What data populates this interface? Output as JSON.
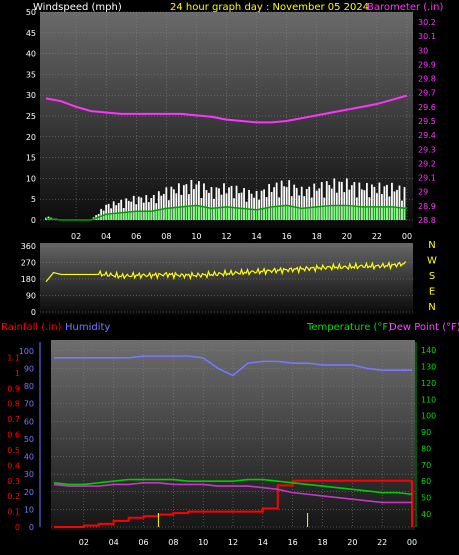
{
  "header": {
    "wind_label": "Windspeed (mph)",
    "title": "24 hour graph day : November 05 2024",
    "baro_label": "Barometer (.in)"
  },
  "colors": {
    "windspeed": "#ffffff",
    "wind_avg": "#00a000",
    "wind_light": "#7cff7c",
    "barometer": "#ff33ff",
    "direction": "#ffff00",
    "rainfall": "#ff0000",
    "humidity": "#7777ff",
    "temperature": "#00cc00",
    "dewpoint": "#cc33cc",
    "tick_yellow": "#ffff00",
    "cardinal": "#ffff00"
  },
  "x_ticks": [
    "02",
    "04",
    "06",
    "08",
    "10",
    "12",
    "14",
    "16",
    "18",
    "20",
    "22",
    "00"
  ],
  "chart_data": [
    {
      "type": "line",
      "name": "wind-barometer",
      "x": [
        0,
        1,
        2,
        3,
        4,
        5,
        6,
        7,
        8,
        9,
        10,
        11,
        12,
        13,
        14,
        15,
        16,
        17,
        18,
        19,
        20,
        21,
        22,
        23,
        24
      ],
      "series": [
        {
          "name": "Windspeed (mph)",
          "axis": "left",
          "values": [
            1,
            0,
            0,
            0,
            4,
            5,
            6,
            6,
            8,
            9,
            10,
            8,
            9,
            8,
            7,
            9,
            10,
            8,
            9,
            10,
            10,
            9,
            9,
            9,
            8
          ]
        },
        {
          "name": "Barometer (.in)",
          "axis": "right",
          "values": [
            29.66,
            29.64,
            29.6,
            29.57,
            29.56,
            29.55,
            29.55,
            29.55,
            29.55,
            29.55,
            29.54,
            29.53,
            29.51,
            29.5,
            29.49,
            29.49,
            29.5,
            29.52,
            29.54,
            29.56,
            29.58,
            29.6,
            29.62,
            29.65,
            29.68
          ]
        }
      ],
      "left_ticks": [
        "0",
        "5",
        "10",
        "15",
        "20",
        "25",
        "30",
        "35",
        "40",
        "45",
        "50"
      ],
      "right_ticks": [
        "28.8",
        "28.9",
        "29",
        "29.1",
        "29.2",
        "29.3",
        "29.4",
        "29.5",
        "29.6",
        "29.7",
        "29.8",
        "29.9",
        "30",
        "30.1",
        "30.2"
      ]
    },
    {
      "type": "scatter",
      "name": "wind-direction",
      "x": [
        0,
        0.5,
        1,
        2,
        3,
        4,
        5,
        6,
        7,
        8,
        9,
        10,
        11,
        12,
        13,
        14,
        15,
        16,
        17,
        18,
        19,
        20,
        21,
        22,
        23,
        24
      ],
      "values": [
        165,
        215,
        205,
        205,
        205,
        205,
        195,
        200,
        200,
        205,
        200,
        200,
        205,
        210,
        215,
        220,
        225,
        230,
        235,
        240,
        245,
        245,
        250,
        250,
        255,
        265
      ],
      "left_ticks": [
        "0",
        "90",
        "180",
        "270",
        "360"
      ],
      "cardinal_labels": [
        "N",
        "W",
        "S",
        "E",
        "N"
      ]
    },
    {
      "type": "line",
      "name": "rain-humidity-temperature",
      "x": [
        0,
        1,
        2,
        3,
        4,
        5,
        6,
        7,
        8,
        9,
        10,
        11,
        12,
        13,
        14,
        15,
        16,
        17,
        18,
        19,
        20,
        21,
        22,
        23,
        24
      ],
      "series": [
        {
          "name": "Rainfall (.in)",
          "axis": "rain",
          "values": [
            0.0,
            0.0,
            0.01,
            0.02,
            0.04,
            0.06,
            0.07,
            0.08,
            0.09,
            0.1,
            0.1,
            0.1,
            0.1,
            0.1,
            0.12,
            0.27,
            0.3,
            0.3,
            0.3,
            0.3,
            0.3,
            0.3,
            0.3,
            0.3,
            0.3
          ]
        },
        {
          "name": "Humidity",
          "axis": "left",
          "values": [
            96,
            96,
            96,
            96,
            96,
            96,
            97,
            97,
            97,
            97,
            96,
            90,
            86,
            93,
            94,
            94,
            93,
            93,
            92,
            92,
            92,
            90,
            89,
            89,
            89
          ]
        },
        {
          "name": "Temperature (°F)",
          "axis": "right",
          "values": [
            59,
            58,
            58,
            59,
            60,
            61,
            61,
            61,
            61,
            60,
            60,
            60,
            60,
            61,
            61,
            60,
            59,
            58,
            57,
            56,
            55,
            54,
            53,
            53,
            52
          ]
        },
        {
          "name": "Dew Point (°F)",
          "axis": "right",
          "values": [
            58,
            57,
            57,
            57,
            58,
            58,
            59,
            59,
            58,
            58,
            58,
            57,
            57,
            57,
            56,
            55,
            53,
            52,
            51,
            50,
            49,
            48,
            47,
            47,
            47
          ]
        }
      ],
      "rain_ticks": [
        "0",
        "0.1",
        "0.2",
        "0.3",
        "0.4",
        "0.5",
        "0.6",
        "0.7",
        "0.8",
        "0.9",
        "1",
        "1.1"
      ],
      "left_ticks": [
        "0",
        "10",
        "20",
        "30",
        "40",
        "50",
        "60",
        "70",
        "80",
        "90",
        "100"
      ],
      "right_ticks": [
        "40",
        "50",
        "60",
        "70",
        "80",
        "90",
        "100",
        "110",
        "120",
        "130",
        "140"
      ],
      "rain_event_ticks": [
        7,
        17
      ]
    }
  ],
  "labels": {
    "rainfall": "Rainfall (.in)",
    "humidity": "Humidity",
    "temperature": "Temperature (°F)",
    "dewpoint": "Dew Point (°F)"
  }
}
